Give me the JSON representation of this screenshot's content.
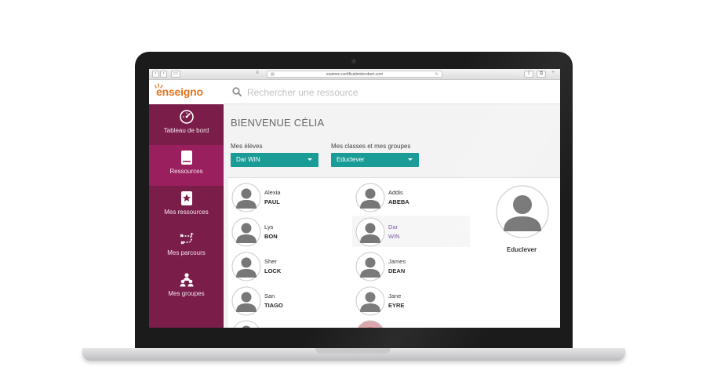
{
  "browser": {
    "url": "examen.certificationlerobert.com"
  },
  "logo": {
    "text": "enseigno"
  },
  "sidebar": {
    "items": [
      {
        "label": "Tableau de bord",
        "icon": "dashboard-gauge-icon",
        "active": true
      },
      {
        "label": "Ressources",
        "icon": "book-icon",
        "active": true
      },
      {
        "label": "Mes ressources",
        "icon": "starred-book-icon",
        "active": false
      },
      {
        "label": "Mes parcours",
        "icon": "route-icon",
        "active": false
      },
      {
        "label": "Mes groupes",
        "icon": "group-icon",
        "active": false
      }
    ]
  },
  "search": {
    "placeholder": "Rechercher une ressource"
  },
  "main": {
    "welcome": "BIENVENUE CÉLIA",
    "students_select": {
      "label": "Mes élèves",
      "value": "Dar WIN"
    },
    "classes_select": {
      "label": "Mes classes et mes groupes",
      "value": "Educlever"
    }
  },
  "students": [
    {
      "first": "Alexia",
      "last": "PAUL"
    },
    {
      "first": "Addis",
      "last": "ABEBA"
    },
    {
      "first": "Lys",
      "last": "BON"
    },
    {
      "first": "Dar",
      "last": "WIN",
      "selected": true
    },
    {
      "first": "Sher",
      "last": "LOCK"
    },
    {
      "first": "James",
      "last": "DEAN"
    },
    {
      "first": "San",
      "last": "TIAGO"
    },
    {
      "first": "Jane",
      "last": "EYRE"
    }
  ],
  "group": {
    "name": "Educlever"
  },
  "colors": {
    "sidebar": "#7a1d48",
    "sidebar_active": "#9a1f5e",
    "accent_teal": "#1a9c96",
    "logo_orange": "#e8731c"
  }
}
